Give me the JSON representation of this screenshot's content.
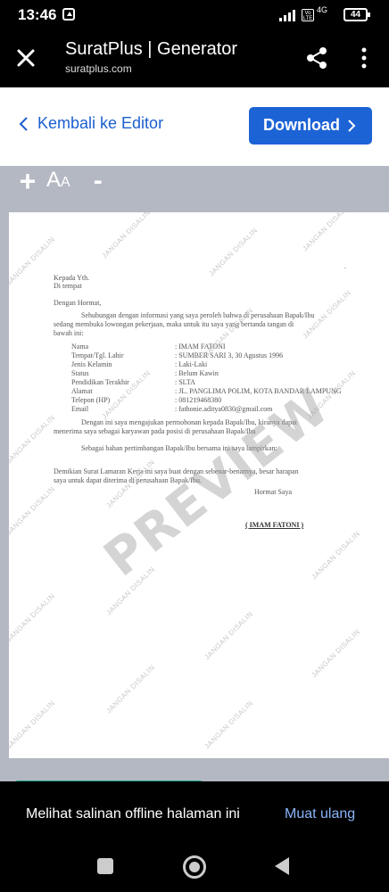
{
  "status_bar": {
    "time": "13:46",
    "network": "4G",
    "volte": "Vo LTE",
    "battery": "44"
  },
  "app_bar": {
    "title": "SuratPlus | Generator",
    "url": "suratplus.com"
  },
  "toolbar": {
    "back_label": "Kembali ke Editor",
    "download_label": "Download",
    "accent_color": "#1c63d6"
  },
  "zoom": {
    "zoom_in": "+",
    "font_size_big": "A",
    "font_size_small": "A",
    "zoom_out": "-"
  },
  "letter": {
    "dot": ".",
    "greeting_to": "Kepada Yth.",
    "place": "Di tempat",
    "salutation": "Dengan Hormat,",
    "intro_1": "Sehubungan dengan informasi yang saya peroleh bahwa di perusahaan Bapak/Ibu",
    "intro_2": "sedang membuka lowongan pekerjaan, maka untuk itu saya yang bertanda tangan di",
    "intro_3": "bawah ini:",
    "fields": [
      {
        "label": "Nama",
        "value": ": IMAM FATONI"
      },
      {
        "label": "Tempat/Tgl. Lahir",
        "value": ": SUMBER SARI 3, 30 Agustus 1996"
      },
      {
        "label": "Jenis Kelamin",
        "value": ": Laki-Laki"
      },
      {
        "label": "Status",
        "value": ": Belum Kawin"
      },
      {
        "label": "Pendidikan Terakhir",
        "value": ": SLTA"
      },
      {
        "label": "Alamat",
        "value": ": JL. PANGLIMA POLIM, KOTA BANDAR LAMPUNG"
      },
      {
        "label": "Telepon (HP)",
        "value": ": 081219468380"
      },
      {
        "label": "Email",
        "value": ": fathonie.aditya0830@gmail.com"
      }
    ],
    "apply_1": "Dengan ini saya mengajukan permohonan kepada Bapak/Ibu, kiranya dapat",
    "apply_2": "menerima saya sebagai karyawan pada posisi di perusahaan Bapak/Ibu",
    "attach": "Sebagai bahan pertimbangan Bapak/Ibu bersama ini saya lampirkan:",
    "closing_1": "Demikian Surat Lamaran Kerja ini saya buat dengan sebenar-benarnya, besar harapan",
    "closing_2": "saya untuk dapat diterima di perusahaan Bapak/Ibu.",
    "regards": "Hormat Saya",
    "signature": "( IMAM FATONI )"
  },
  "watermark": {
    "preview": "PREVIEW",
    "tiled": "JANGAN DISALIN"
  },
  "snackbar": {
    "message": "Melihat salinan offline halaman ini",
    "action": "Muat ulang"
  }
}
